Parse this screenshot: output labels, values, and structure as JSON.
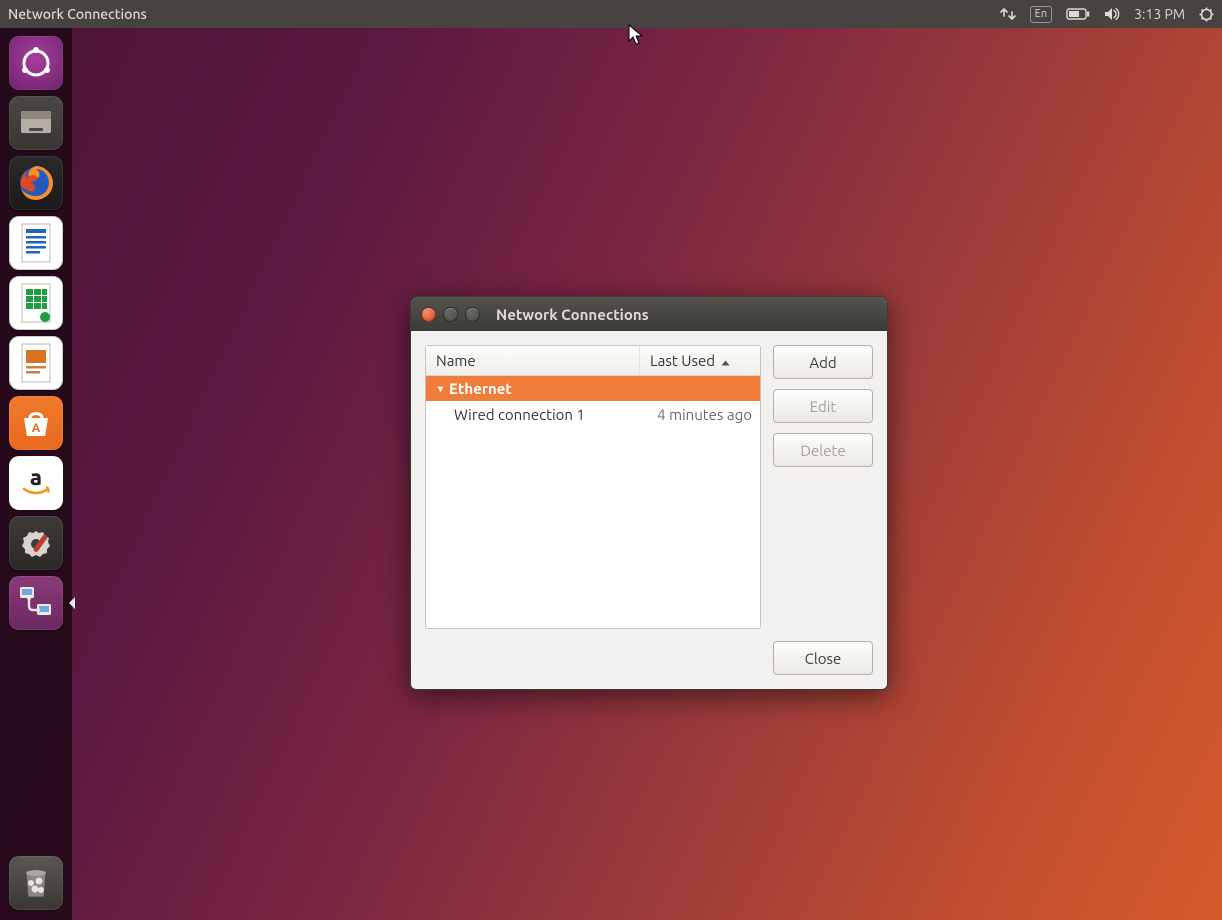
{
  "menubar": {
    "title": "Network Connections",
    "language": "En",
    "time": "3:13 PM"
  },
  "launcher": {
    "items": [
      {
        "name": "dash",
        "label": "Ubuntu Dash"
      },
      {
        "name": "files",
        "label": "Files"
      },
      {
        "name": "firefox",
        "label": "Firefox"
      },
      {
        "name": "writer",
        "label": "LibreOffice Writer"
      },
      {
        "name": "calc",
        "label": "LibreOffice Calc"
      },
      {
        "name": "impress",
        "label": "LibreOffice Impress"
      },
      {
        "name": "software",
        "label": "Ubuntu Software"
      },
      {
        "name": "amazon",
        "label": "Amazon"
      },
      {
        "name": "settings",
        "label": "System Settings"
      },
      {
        "name": "network",
        "label": "Network Connections"
      }
    ],
    "trash_label": "Trash"
  },
  "dialog": {
    "title": "Network Connections",
    "columns": {
      "name": "Name",
      "last_used": "Last Used"
    },
    "group": "Ethernet",
    "connections": [
      {
        "name": "Wired connection 1",
        "last_used": "4 minutes ago"
      }
    ],
    "buttons": {
      "add": "Add",
      "edit": "Edit",
      "delete": "Delete",
      "close": "Close"
    }
  }
}
